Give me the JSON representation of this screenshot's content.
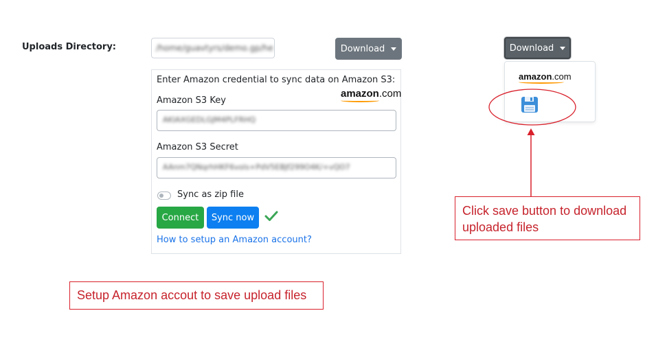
{
  "uploads": {
    "label": "Uploads Directory:",
    "path_value": "/home/guavtyrs/demo.gp/he"
  },
  "download_button": {
    "label": "Download"
  },
  "download_button_open": {
    "label": "Download"
  },
  "s3_panel": {
    "intro": "Enter Amazon credential to sync data on Amazon S3:",
    "key_label": "Amazon S3 Key",
    "key_value": "AKIAXGEDLGJM4PLFRHQ",
    "secret_label": "Amazon S3 Secret",
    "secret_value": "AAnm7QNqrhHKF6vols+PdV5EBJf299O4K/+vQO7",
    "zip_label": "Sync as zip file",
    "connect_label": "Connect",
    "sync_label": "Sync now",
    "help_link": "How to setup an Amazon account?"
  },
  "amazon_logo": {
    "word": "amazon",
    "tld": ".com"
  },
  "dropdown_amazon_logo": {
    "word": "amazon",
    "tld": ".com"
  },
  "callouts": {
    "save_hint": "Click save button to download uploaded files",
    "setup_hint": "Setup Amazon accout to save upload files"
  },
  "colors": {
    "annotation_red": "#d9202b",
    "success_check": "#3aa655",
    "amazon_orange": "#ff9900",
    "floppy_blue": "#3d8fd9"
  },
  "icons": {
    "check": "check-icon",
    "save": "floppy-disk-icon",
    "arrow": "arrow-up-icon"
  }
}
